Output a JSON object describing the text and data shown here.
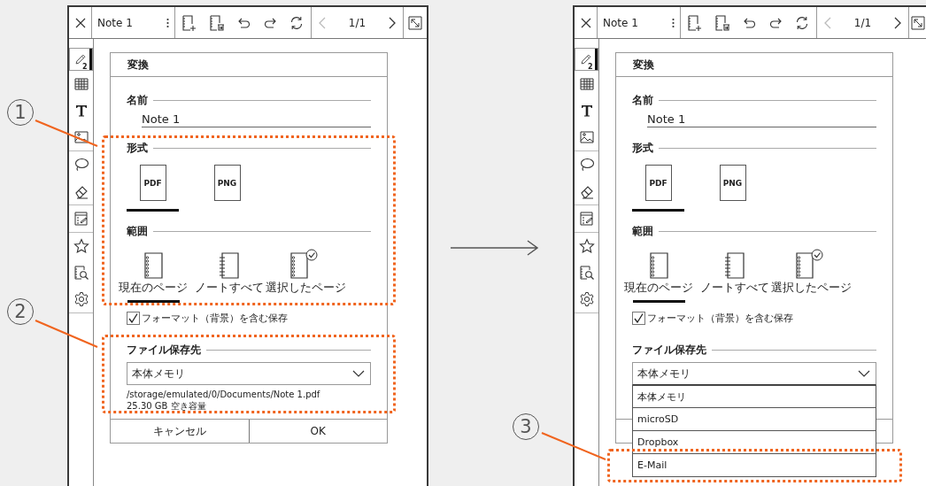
{
  "screens": [
    {
      "topbar": {
        "title": "Note 1",
        "pager": {
          "text": "1/1",
          "prev_disabled": true,
          "next_disabled": false
        }
      },
      "sidebar_groups": [
        {
          "tools": [
            {
              "kind": "pen",
              "selected": true,
              "badge": "2"
            },
            {
              "kind": "table",
              "selected": false
            },
            {
              "kind": "text",
              "selected": false
            },
            {
              "kind": "image",
              "selected": false
            }
          ]
        },
        {
          "tools": [
            {
              "kind": "lasso",
              "selected": false
            },
            {
              "kind": "eraser",
              "selected": false
            }
          ]
        },
        {
          "tools": [
            {
              "kind": "note",
              "selected": false
            }
          ]
        },
        {
          "tools": [
            {
              "kind": "star",
              "selected": false
            },
            {
              "kind": "search",
              "selected": false
            },
            {
              "kind": "settings",
              "selected": false
            }
          ]
        }
      ],
      "dialog": {
        "title": "変換",
        "name_label": "名前",
        "name_value": "Note 1",
        "format_label": "形式",
        "formats": [
          {
            "label": "PDF",
            "selected": true
          },
          {
            "label": "PNG",
            "selected": false
          }
        ],
        "range_label": "範囲",
        "ranges": [
          {
            "kind": "current",
            "label": "現在のページ",
            "selected": true
          },
          {
            "kind": "all",
            "label": "ノートすべて",
            "selected": false
          },
          {
            "kind": "chosen",
            "label": "選択したページ",
            "selected": false
          }
        ],
        "save_format": {
          "label": "フォーマット（背景）を含む保存",
          "checked": true
        },
        "destination_label": "ファイル保存先",
        "destination": {
          "value": "本体メモリ",
          "expanded": false
        },
        "path": "/storage/emulated/0/Documents/Note 1.pdf",
        "free_space": "25.30 GB 空き容量",
        "buttons": [
          "キャンセル",
          "OK"
        ]
      }
    },
    {
      "topbar": {
        "title": "Note 1",
        "pager": {
          "text": "1/1",
          "prev_disabled": true,
          "next_disabled": false
        }
      },
      "sidebar_groups": [
        {
          "tools": [
            {
              "kind": "pen",
              "selected": true,
              "badge": "2"
            },
            {
              "kind": "table",
              "selected": false
            },
            {
              "kind": "text",
              "selected": false
            },
            {
              "kind": "image",
              "selected": false
            }
          ]
        },
        {
          "tools": [
            {
              "kind": "lasso",
              "selected": false
            },
            {
              "kind": "eraser",
              "selected": false
            }
          ]
        },
        {
          "tools": [
            {
              "kind": "note",
              "selected": false
            }
          ]
        },
        {
          "tools": [
            {
              "kind": "star",
              "selected": false
            },
            {
              "kind": "search",
              "selected": false
            },
            {
              "kind": "settings",
              "selected": false
            }
          ]
        }
      ],
      "dialog": {
        "title": "変換",
        "name_label": "名前",
        "name_value": "Note 1",
        "format_label": "形式",
        "formats": [
          {
            "label": "PDF",
            "selected": true
          },
          {
            "label": "PNG",
            "selected": false
          }
        ],
        "range_label": "範囲",
        "ranges": [
          {
            "kind": "current",
            "label": "現在のページ",
            "selected": true
          },
          {
            "kind": "all",
            "label": "ノートすべて",
            "selected": false
          },
          {
            "kind": "chosen",
            "label": "選択したページ",
            "selected": false
          }
        ],
        "save_format": {
          "label": "フォーマット（背景）を含む保存",
          "checked": true
        },
        "destination_label": "ファイル保存先",
        "destination": {
          "value": "本体メモリ",
          "expanded": true,
          "options": [
            "本体メモリ",
            "microSD",
            "Dropbox",
            "E-Mail"
          ]
        }
      }
    }
  ],
  "callouts": [
    {
      "number": "1"
    },
    {
      "number": "2"
    },
    {
      "number": "3"
    }
  ]
}
